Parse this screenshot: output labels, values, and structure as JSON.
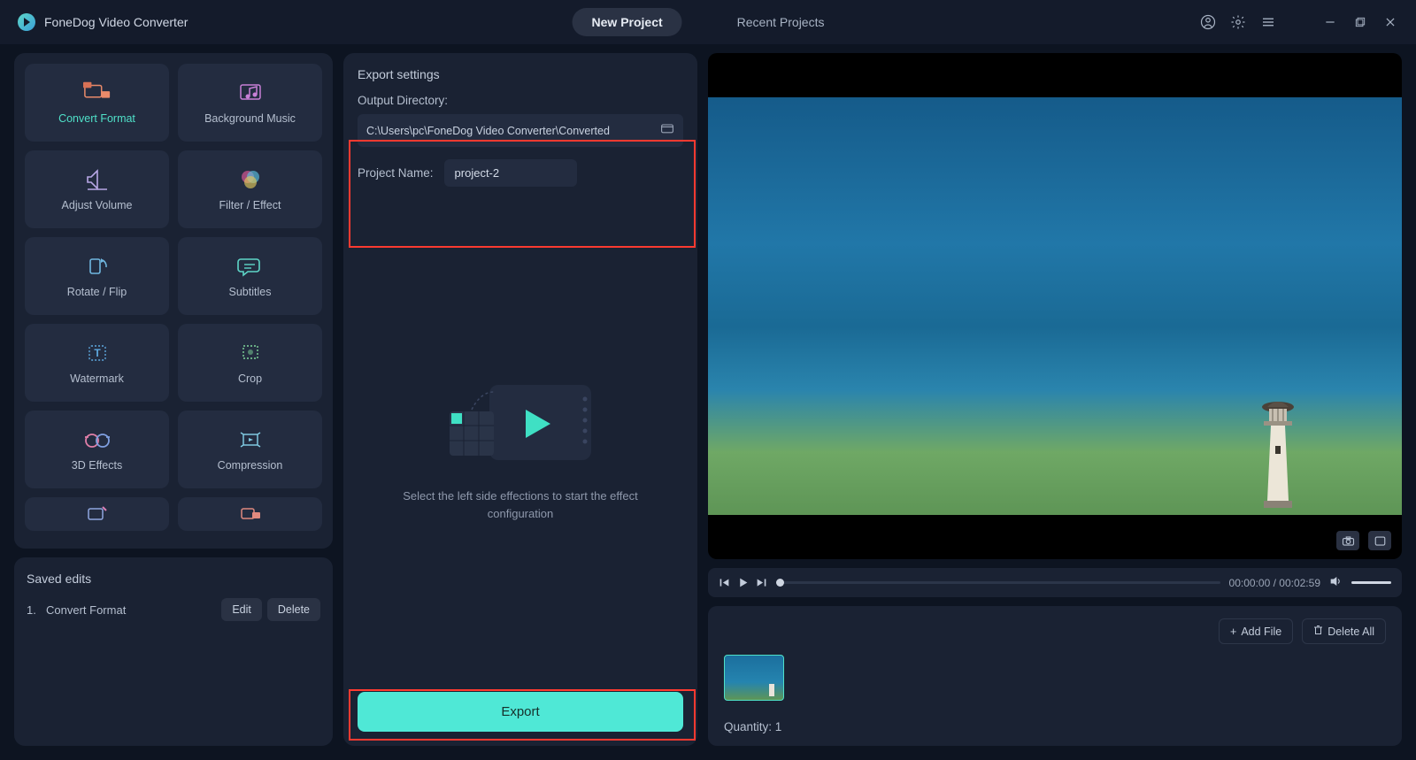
{
  "app": {
    "title": "FoneDog Video Converter"
  },
  "tabs": {
    "new_project": "New Project",
    "recent_projects": "Recent Projects"
  },
  "tools": [
    {
      "id": "convert-format",
      "label": "Convert Format",
      "active": true
    },
    {
      "id": "background-music",
      "label": "Background Music"
    },
    {
      "id": "adjust-volume",
      "label": "Adjust Volume"
    },
    {
      "id": "filter-effect",
      "label": "Filter / Effect"
    },
    {
      "id": "rotate-flip",
      "label": "Rotate / Flip"
    },
    {
      "id": "subtitles",
      "label": "Subtitles"
    },
    {
      "id": "watermark",
      "label": "Watermark"
    },
    {
      "id": "crop",
      "label": "Crop"
    },
    {
      "id": "3d-effects",
      "label": "3D Effects"
    },
    {
      "id": "compression",
      "label": "Compression"
    }
  ],
  "saved": {
    "title": "Saved edits",
    "items": [
      {
        "index": "1.",
        "name": "Convert Format"
      }
    ],
    "edit": "Edit",
    "delete": "Delete"
  },
  "export": {
    "title": "Export settings",
    "dir_label": "Output Directory:",
    "dir_value": "C:\\Users\\pc\\FoneDog Video Converter\\Converted",
    "name_label": "Project Name:",
    "name_value": "project-2",
    "hint": "Select the left side effections to start the effect configuration",
    "button": "Export"
  },
  "player": {
    "time_current": "00:00:00",
    "time_sep": " / ",
    "time_total": "00:02:59"
  },
  "files": {
    "add": "Add File",
    "delete_all": "Delete All",
    "quantity_label": "Quantity: ",
    "quantity_value": "1"
  }
}
